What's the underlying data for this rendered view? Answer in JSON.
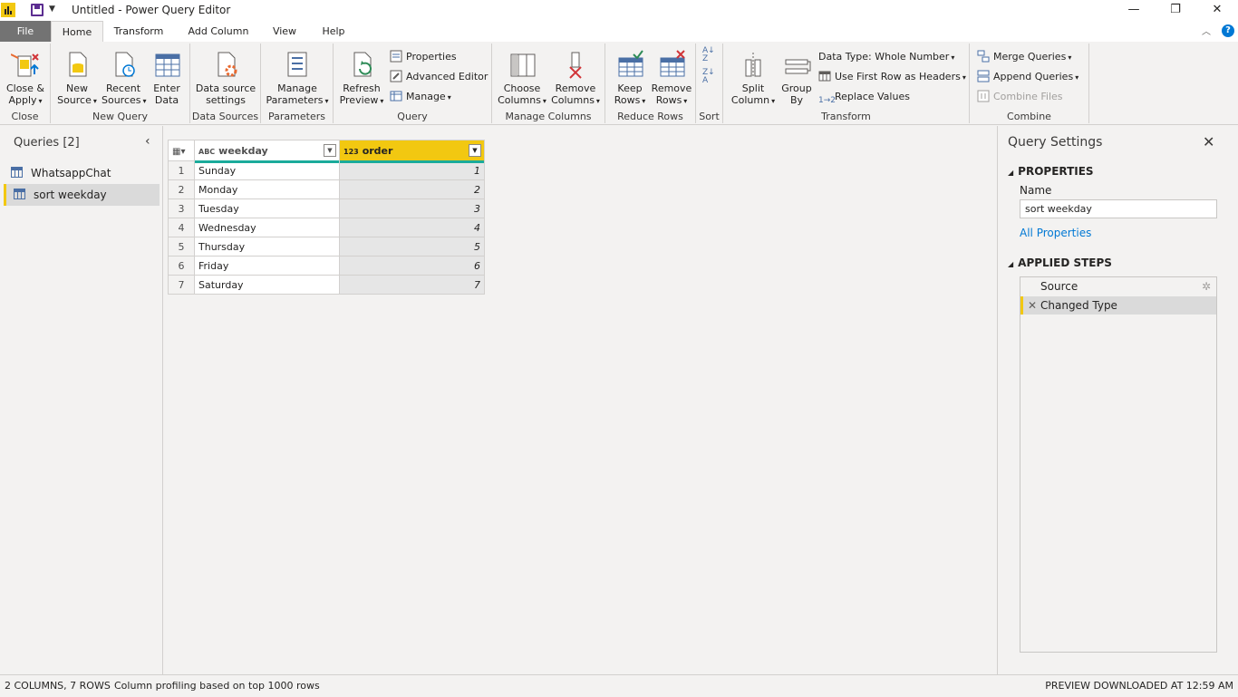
{
  "window": {
    "title": "Untitled - Power Query Editor"
  },
  "tabs": [
    "File",
    "Home",
    "Transform",
    "Add Column",
    "View",
    "Help"
  ],
  "ribbon": {
    "close_group": {
      "label": "Close",
      "close_apply": "Close &",
      "close_apply2": "Apply"
    },
    "new_query_group": {
      "label": "New Query",
      "new_source": [
        "New",
        "Source"
      ],
      "recent_sources": [
        "Recent",
        "Sources"
      ],
      "enter_data": [
        "Enter",
        "Data"
      ]
    },
    "data_sources_group": {
      "label": "Data Sources",
      "settings": [
        "Data source",
        "settings"
      ]
    },
    "parameters_group": {
      "label": "Parameters",
      "manage": [
        "Manage",
        "Parameters"
      ]
    },
    "query_group": {
      "label": "Query",
      "refresh": [
        "Refresh",
        "Preview"
      ],
      "properties": "Properties",
      "advanced_editor": "Advanced Editor",
      "manage": "Manage"
    },
    "manage_columns_group": {
      "label": "Manage Columns",
      "choose": [
        "Choose",
        "Columns"
      ],
      "remove": [
        "Remove",
        "Columns"
      ]
    },
    "reduce_rows_group": {
      "label": "Reduce Rows",
      "keep": [
        "Keep",
        "Rows"
      ],
      "remove": [
        "Remove",
        "Rows"
      ]
    },
    "sort_group": {
      "label": "Sort"
    },
    "transform_group": {
      "label": "Transform",
      "split": [
        "Split",
        "Column"
      ],
      "group_by": [
        "Group",
        "By"
      ],
      "data_type": "Data Type: Whole Number",
      "first_row": "Use First Row as Headers",
      "replace": "Replace Values"
    },
    "combine_group": {
      "label": "Combine",
      "merge": "Merge Queries",
      "append": "Append Queries",
      "combine_files": "Combine Files"
    }
  },
  "queries_pane": {
    "title": "Queries [2]",
    "items": [
      {
        "label": "WhatsappChat"
      },
      {
        "label": "sort weekday"
      }
    ]
  },
  "grid": {
    "columns": [
      {
        "type": "ABC",
        "name": "weekday"
      },
      {
        "type": "123",
        "name": "order"
      }
    ],
    "rows": [
      {
        "n": "1",
        "weekday": "Sunday",
        "order": "1"
      },
      {
        "n": "2",
        "weekday": "Monday",
        "order": "2"
      },
      {
        "n": "3",
        "weekday": "Tuesday",
        "order": "3"
      },
      {
        "n": "4",
        "weekday": "Wednesday",
        "order": "4"
      },
      {
        "n": "5",
        "weekday": "Thursday",
        "order": "5"
      },
      {
        "n": "6",
        "weekday": "Friday",
        "order": "6"
      },
      {
        "n": "7",
        "weekday": "Saturday",
        "order": "7"
      }
    ]
  },
  "settings_pane": {
    "title": "Query Settings",
    "properties": "PROPERTIES",
    "name_label": "Name",
    "name_value": "sort weekday",
    "all_properties": "All Properties",
    "applied_steps": "APPLIED STEPS",
    "steps": [
      "Source",
      "Changed Type"
    ]
  },
  "status": {
    "left": "2 COLUMNS, 7 ROWS",
    "profiling": "Column profiling based on top 1000 rows",
    "right": "PREVIEW DOWNLOADED AT 12:59 AM"
  },
  "colors": {
    "accent": "#f2c811",
    "column_quality": "#1aab9b",
    "link": "#0078d4"
  }
}
